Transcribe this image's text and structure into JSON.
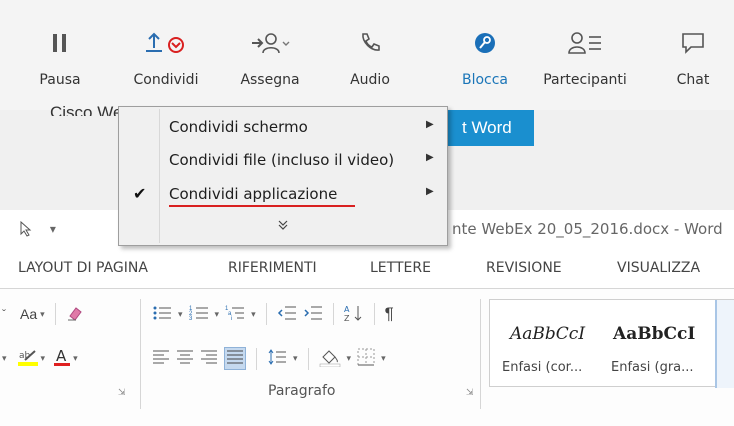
{
  "webex_toolbar": {
    "buttons": [
      {
        "key": "pause",
        "label": "Pausa",
        "icon": "pause-icon"
      },
      {
        "key": "share",
        "label": "Condividi",
        "icon": "share-upload-icon"
      },
      {
        "key": "assign",
        "label": "Assegna",
        "icon": "assign-person-icon"
      },
      {
        "key": "audio",
        "label": "Audio",
        "icon": "phone-icon"
      },
      {
        "key": "lock",
        "label": "Blocca",
        "icon": "lock-key-icon"
      },
      {
        "key": "participants",
        "label": "Partecipanti",
        "icon": "participants-icon"
      },
      {
        "key": "chat",
        "label": "Chat",
        "icon": "chat-bubble-icon"
      }
    ],
    "accent_color": "#1a75b8"
  },
  "webex_content": {
    "cisco_text": "Cisco WebEx",
    "word_button_label": "t Word"
  },
  "word": {
    "title": "nte WebEx 20_05_2016.docx - Word",
    "tabs": [
      "LAYOUT DI PAGINA",
      "RIFERIMENTI",
      "LETTERE",
      "REVISIONE",
      "VISUALIZZA"
    ],
    "paragraph_group_label": "Paragrafo",
    "font_size_dropdown": "Aa",
    "styles": [
      {
        "sample": "AaBbCcI",
        "name": "Enfasi (cor..."
      },
      {
        "sample": "AaBbCcI",
        "name": "Enfasi (gra..."
      }
    ]
  },
  "share_menu": {
    "items": [
      {
        "label": "Condividi schermo",
        "checked": false,
        "submenu": true
      },
      {
        "label": "Condividi file (incluso il video)",
        "checked": false,
        "submenu": true
      },
      {
        "label": "Condividi applicazione",
        "checked": true,
        "submenu": true,
        "highlight_underline_color": "#d92020"
      }
    ],
    "more_glyph": "»"
  }
}
